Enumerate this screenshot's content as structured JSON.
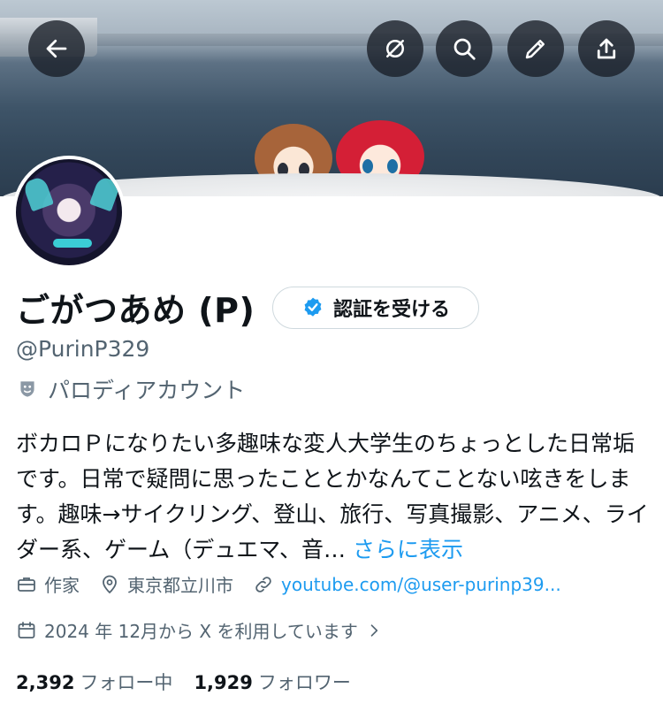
{
  "header": {
    "back_icon": "arrow-left-icon",
    "mute_icon": "slash-circle-icon",
    "search_icon": "search-icon",
    "edit_icon": "pencil-icon",
    "share_icon": "share-icon"
  },
  "profile": {
    "display_name": "ごがつあめ (P)",
    "verify_button_label": "認証を受ける",
    "handle": "@PurinP329",
    "parody_label": "パロディアカウント",
    "bio_text": "ボカロＰになりたい多趣味な変人大学生のちょっとした日常垢です。日常で疑問に思ったこととかなんてことない呟きをします。趣味→サイクリング、登山、旅行、写真撮影、アニメ、ライダー系、ゲーム（デュエマ、音…",
    "bio_more": "さらに表示",
    "profession": "作家",
    "location": "東京都立川市",
    "website": "youtube.com/@user-purinp39...",
    "joined": "2024 年 12月から X を利用しています",
    "following_count": "2,392",
    "following_label": "フォロー中",
    "followers_count": "1,929",
    "followers_label": "フォロワー"
  },
  "colors": {
    "accent": "#1d9bf0",
    "secondary_text": "#536471",
    "verify_badge": "#1d9bf0"
  }
}
